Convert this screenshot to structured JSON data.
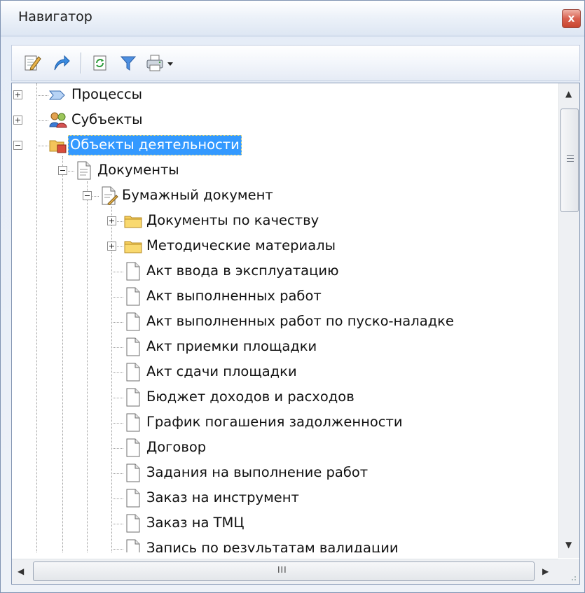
{
  "window": {
    "title": "Навигатор",
    "close_glyph": "x"
  },
  "toolbar": {
    "buttons": [
      "edit-icon",
      "go-to-icon",
      "refresh-icon",
      "filter-icon",
      "print-icon",
      "dropdown-arrow-icon"
    ]
  },
  "tree": {
    "items": [
      {
        "label": "Процессы",
        "icon": "process-arrow-icon",
        "state": "collapsed"
      },
      {
        "label": "Субъекты",
        "icon": "people-icon",
        "state": "collapsed"
      },
      {
        "label": "Объекты деятельности",
        "icon": "folder-object-icon",
        "state": "expanded",
        "selected": true
      },
      {
        "label": "Документы",
        "icon": "document-icon",
        "state": "expanded"
      },
      {
        "label": "Бумажный документ",
        "icon": "paper-document-icon",
        "state": "expanded"
      },
      {
        "label": "Документы по качеству",
        "icon": "folder-icon",
        "state": "collapsed"
      },
      {
        "label": "Методические материалы",
        "icon": "folder-icon",
        "state": "collapsed"
      },
      {
        "label": "Акт ввода в эксплуатацию",
        "icon": "document-icon"
      },
      {
        "label": "Акт выполненных работ",
        "icon": "document-icon"
      },
      {
        "label": "Акт выполненных работ по пуско-наладке",
        "icon": "document-icon"
      },
      {
        "label": "Акт приемки площадки",
        "icon": "document-icon"
      },
      {
        "label": "Акт сдачи площадки",
        "icon": "document-icon"
      },
      {
        "label": "Бюджет доходов и расходов",
        "icon": "document-icon"
      },
      {
        "label": "График погашения задолженности",
        "icon": "document-icon"
      },
      {
        "label": "Договор",
        "icon": "document-icon"
      },
      {
        "label": "Задания на выполнение работ",
        "icon": "document-icon"
      },
      {
        "label": "Заказ на инструмент",
        "icon": "document-icon"
      },
      {
        "label": "Заказ на ТМЦ",
        "icon": "document-icon"
      },
      {
        "label": "Запись по результатам валидации",
        "icon": "document-icon"
      }
    ]
  },
  "scrollbars": {
    "horizontal_grip": "III"
  }
}
